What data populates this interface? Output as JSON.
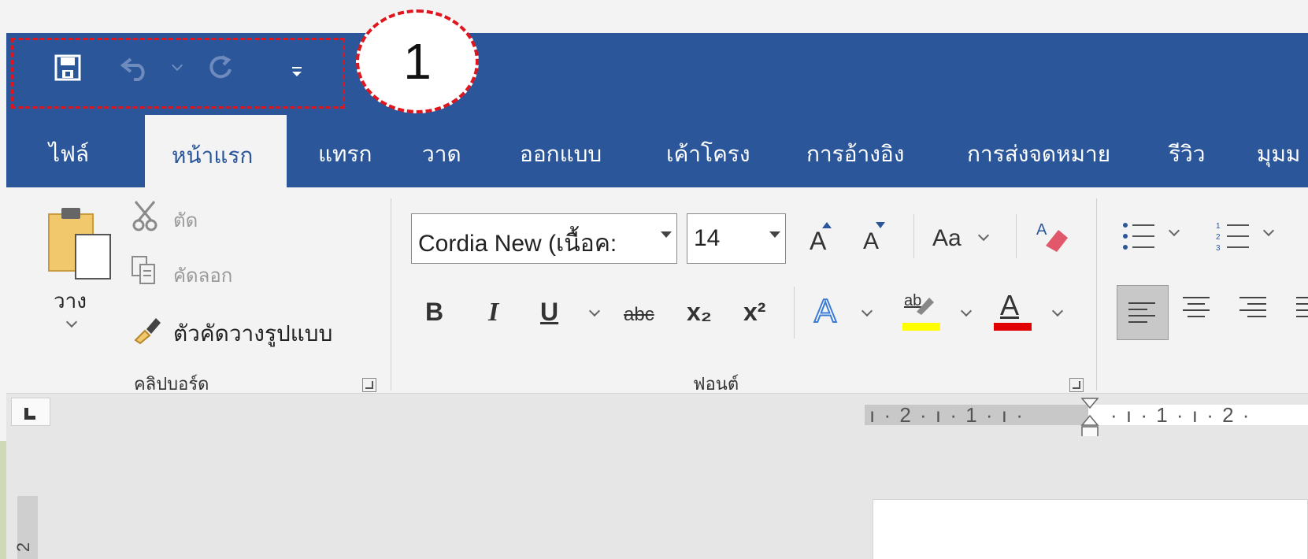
{
  "callout": {
    "number": "1"
  },
  "tabs": {
    "items": [
      "ไฟล์",
      "หน้าแรก",
      "แทรก",
      "วาด",
      "ออกแบบ",
      "เค้าโครง",
      "การอ้างอิง",
      "การส่งจดหมาย",
      "รีวิว",
      "มุมม"
    ],
    "active": "หน้าแรก"
  },
  "clipboard": {
    "paste_label": "วาง",
    "cut_label": "ตัด",
    "copy_label": "คัดลอก",
    "format_painter_label": "ตัวคัดวางรูปแบบ",
    "group_label": "คลิปบอร์ด"
  },
  "font": {
    "font_name": "Cordia New (เนื้อค:",
    "font_size": "14",
    "change_case_label": "Aa",
    "bold_label": "B",
    "italic_label": "I",
    "underline_label": "U",
    "strikethrough_label": "abc",
    "subscript_label": "x₂",
    "superscript_label": "x²",
    "text_effects_label": "A",
    "highlight_label": "ab",
    "font_color_label": "A",
    "group_label": "ฟอนต์",
    "highlight_color": "#ffff00",
    "font_color": "#e00000"
  },
  "ruler": {
    "left_text": "ı · 2 · ı · 1 · ı ·",
    "right_text": "· ı · 1 · ı · 2 ·"
  },
  "vertical_ruler": {
    "label": "2"
  },
  "colors": {
    "titlebar": "#2b579a",
    "callout_border": "#e0161f"
  }
}
